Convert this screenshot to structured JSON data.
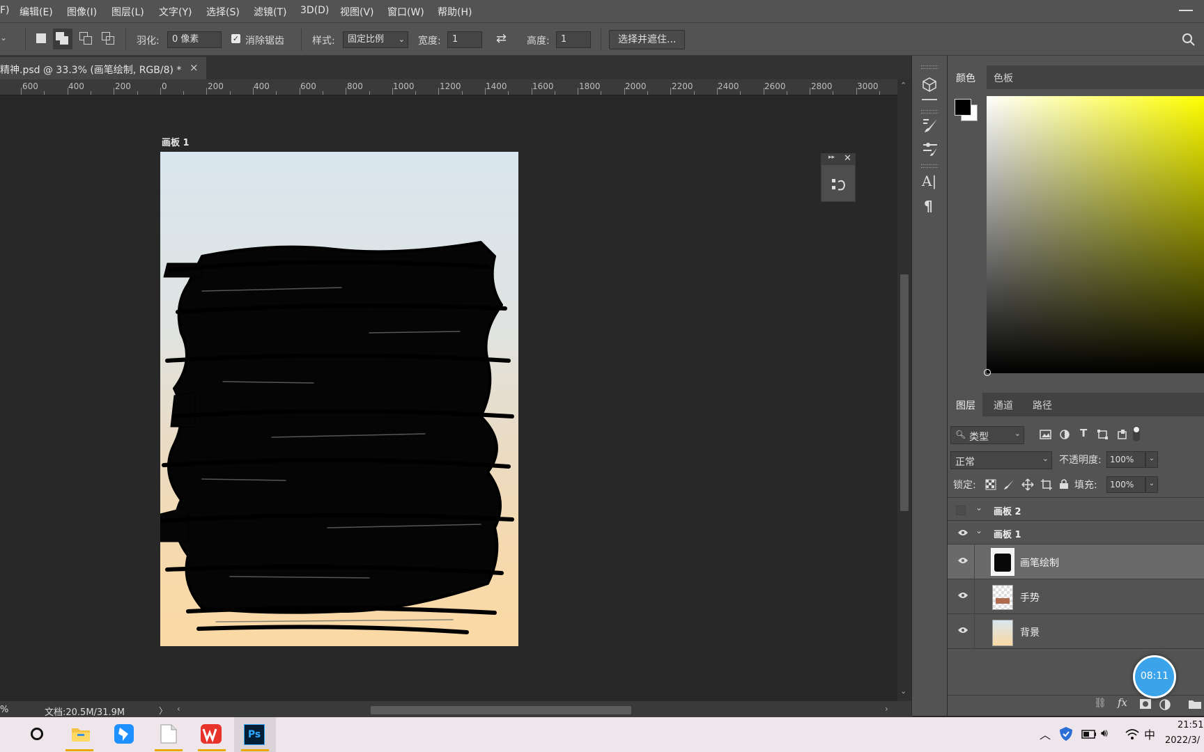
{
  "menu": [
    "F)",
    "编辑(E)",
    "图像(I)",
    "图层(L)",
    "文字(Y)",
    "选择(S)",
    "滤镜(T)",
    "3D(D)",
    "视图(V)",
    "窗口(W)",
    "帮助(H)"
  ],
  "options": {
    "feather_label": "羽化:",
    "feather_value": "0 像素",
    "antialias_label": "消除锯齿",
    "style_label": "样式:",
    "style_value": "固定比例",
    "width_label": "宽度:",
    "width_value": "1",
    "height_label": "高度:",
    "height_value": "1",
    "select_mask_button": "选择并遮住..."
  },
  "document": {
    "tab_title": "精神.psd @ 33.3% (画笔绘制, RGB/8) *",
    "close": "×",
    "artboard_label": "画板 1"
  },
  "ruler": [
    "600",
    "400",
    "200",
    "0",
    "200",
    "400",
    "600",
    "800",
    "1000",
    "1200",
    "1400",
    "1600",
    "1800",
    "2000",
    "2200",
    "2400",
    "2600",
    "2800",
    "3000"
  ],
  "status": {
    "zoom_fragment": "%",
    "doc_size": "文档:20.5M/31.9M",
    "arrow": "〉"
  },
  "color_panel": {
    "tabs": [
      "颜色",
      "色板"
    ],
    "foreground": "#000000",
    "background": "#ffffff",
    "hue_color": "#ffff00"
  },
  "layers_panel": {
    "tabs": [
      "图层",
      "通道",
      "路径"
    ],
    "filter_value": "类型",
    "blend_mode": "正常",
    "opacity_label": "不透明度:",
    "opacity_value": "100%",
    "lock_label": "锁定:",
    "fill_label": "填充:",
    "fill_value": "100%",
    "layers": [
      {
        "name": "画板 2",
        "type": "group",
        "visible": false,
        "bold": true
      },
      {
        "name": "画板 1",
        "type": "group",
        "visible": true,
        "bold": true
      },
      {
        "name": "画笔绘制",
        "type": "layer",
        "visible": true,
        "selected": true
      },
      {
        "name": "手势",
        "type": "layer",
        "visible": true
      },
      {
        "name": "背景",
        "type": "layer",
        "visible": true
      }
    ]
  },
  "timer": "08:11",
  "taskbar": {
    "ime": "中",
    "time": "21:51",
    "date": "2022/3/"
  }
}
